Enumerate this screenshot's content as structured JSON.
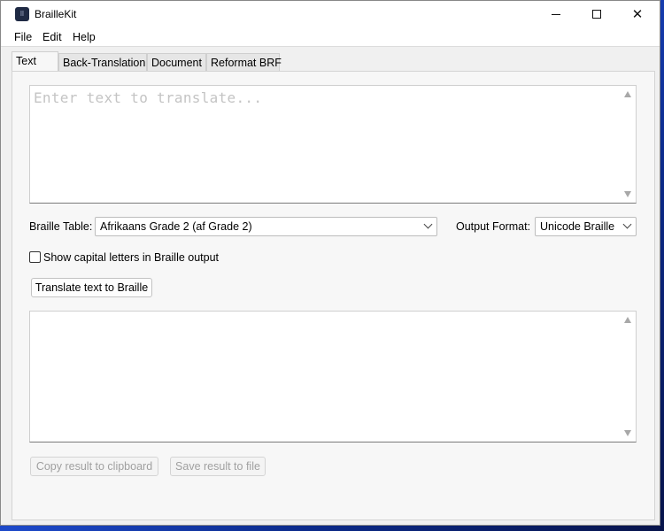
{
  "window": {
    "title": "BrailleKit",
    "icon": "braille-app-icon",
    "icon_glyph": "⠿",
    "controls": {
      "minimize": "minimize-icon",
      "maximize": "maximize-icon",
      "close": "close-icon",
      "close_glyph": "✕"
    }
  },
  "menu": [
    "File",
    "Edit",
    "Help"
  ],
  "tabs": [
    {
      "label": "Text",
      "active": true
    },
    {
      "label": "Back-Translation",
      "active": false
    },
    {
      "label": "Document",
      "active": false
    },
    {
      "label": "Reformat BRF",
      "active": false
    }
  ],
  "input": {
    "placeholder": "Enter text to translate...",
    "value": ""
  },
  "braille_table": {
    "label": "Braille Table:",
    "selected": "Afrikaans Grade 2 (af Grade 2)"
  },
  "output_format": {
    "label": "Output Format:",
    "selected": "Unicode Braille"
  },
  "capitals_checkbox": {
    "label": "Show capital letters in Braille output",
    "checked": false
  },
  "translate_button": "Translate text to Braille",
  "output": {
    "value": ""
  },
  "copy_button": "Copy result to clipboard",
  "save_button": "Save result to file",
  "colors": {
    "desktop_accent": "#1d49c9",
    "window_bg": "#f0f0f0",
    "disabled_text": "#a0a0a0"
  }
}
